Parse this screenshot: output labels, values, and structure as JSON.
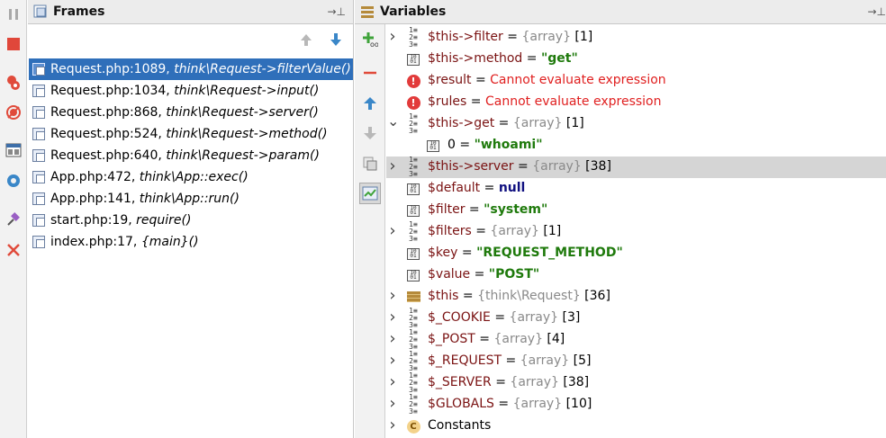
{
  "left_toolbar": {
    "icons": [
      "pause-icon",
      "stop-icon",
      "view-breakpoints-icon",
      "mute-breakpoints-icon",
      "restore-layout-icon",
      "settings-icon",
      "pin-icon",
      "close-icon"
    ]
  },
  "frames": {
    "title": "Frames",
    "items": [
      {
        "location": "Request.php:1089,",
        "method": "think\\Request->filterValue()",
        "selected": true
      },
      {
        "location": "Request.php:1034,",
        "method": "think\\Request->input()"
      },
      {
        "location": "Request.php:868,",
        "method": "think\\Request->server()"
      },
      {
        "location": "Request.php:524,",
        "method": "think\\Request->method()"
      },
      {
        "location": "Request.php:640,",
        "method": "think\\Request->param()"
      },
      {
        "location": "App.php:472,",
        "method": "think\\App::exec()"
      },
      {
        "location": "App.php:141,",
        "method": "think\\App::run()"
      },
      {
        "location": "start.php:19,",
        "method": "require()"
      },
      {
        "location": "index.php:17,",
        "method": "{main}()"
      }
    ]
  },
  "variables": {
    "title": "Variables",
    "items": [
      {
        "arrow": "right",
        "icon": "array",
        "name": "$this->filter",
        "eq": " = ",
        "type": "{array}",
        "count": " [1]",
        "value": "",
        "vclass": ""
      },
      {
        "arrow": "",
        "icon": "prim",
        "name": "$this->method",
        "eq": " = ",
        "type": "",
        "count": "",
        "value": "\"get\"",
        "vclass": "vstr"
      },
      {
        "arrow": "",
        "icon": "err",
        "name": "$result",
        "eq": " = ",
        "type": "",
        "count": "",
        "value": "Cannot evaluate expression",
        "vclass": "verr"
      },
      {
        "arrow": "",
        "icon": "err",
        "name": "$rules",
        "eq": " = ",
        "type": "",
        "count": "",
        "value": "Cannot evaluate expression",
        "vclass": "verr"
      },
      {
        "arrow": "down",
        "icon": "array",
        "name": "$this->get",
        "eq": " = ",
        "type": "{array}",
        "count": " [1]",
        "value": "",
        "vclass": ""
      },
      {
        "arrow": "",
        "icon": "prim",
        "indent": true,
        "name": "0",
        "eq": " = ",
        "type": "",
        "count": "",
        "value": "\"whoami\"",
        "vclass": "vstr",
        "namecls": "vplain"
      },
      {
        "arrow": "right",
        "icon": "array",
        "name": "$this->server",
        "eq": " = ",
        "type": "{array}",
        "count": " [38]",
        "value": "",
        "vclass": "",
        "selected": true
      },
      {
        "arrow": "",
        "icon": "prim",
        "name": "$default",
        "eq": " = ",
        "type": "",
        "count": "",
        "value": "null",
        "vclass": "vkw"
      },
      {
        "arrow": "",
        "icon": "prim",
        "name": "$filter",
        "eq": " = ",
        "type": "",
        "count": "",
        "value": "\"system\"",
        "vclass": "vstr"
      },
      {
        "arrow": "right",
        "icon": "array",
        "name": "$filters",
        "eq": " = ",
        "type": "{array}",
        "count": " [1]",
        "value": "",
        "vclass": ""
      },
      {
        "arrow": "",
        "icon": "prim",
        "name": "$key",
        "eq": " = ",
        "type": "",
        "count": "",
        "value": "\"REQUEST_METHOD\"",
        "vclass": "vstr"
      },
      {
        "arrow": "",
        "icon": "prim",
        "name": "$value",
        "eq": " = ",
        "type": "",
        "count": "",
        "value": "\"POST\"",
        "vclass": "vstr"
      },
      {
        "arrow": "right",
        "icon": "obj",
        "name": "$this",
        "eq": " = ",
        "type": "{think\\Request}",
        "count": " [36]",
        "value": "",
        "vclass": ""
      },
      {
        "arrow": "right",
        "icon": "array",
        "name": "$_COOKIE",
        "eq": " = ",
        "type": "{array}",
        "count": " [3]",
        "value": "",
        "vclass": ""
      },
      {
        "arrow": "right",
        "icon": "array",
        "name": "$_POST",
        "eq": " = ",
        "type": "{array}",
        "count": " [4]",
        "value": "",
        "vclass": ""
      },
      {
        "arrow": "right",
        "icon": "array",
        "name": "$_REQUEST",
        "eq": " = ",
        "type": "{array}",
        "count": " [5]",
        "value": "",
        "vclass": ""
      },
      {
        "arrow": "right",
        "icon": "array",
        "name": "$_SERVER",
        "eq": " = ",
        "type": "{array}",
        "count": " [38]",
        "value": "",
        "vclass": ""
      },
      {
        "arrow": "right",
        "icon": "array",
        "name": "$GLOBALS",
        "eq": " = ",
        "type": "{array}",
        "count": " [10]",
        "value": "",
        "vclass": ""
      },
      {
        "arrow": "right",
        "icon": "const",
        "name": "Constants",
        "eq": "",
        "type": "",
        "count": "",
        "value": "",
        "vclass": "",
        "namecls": "vplain"
      }
    ]
  }
}
